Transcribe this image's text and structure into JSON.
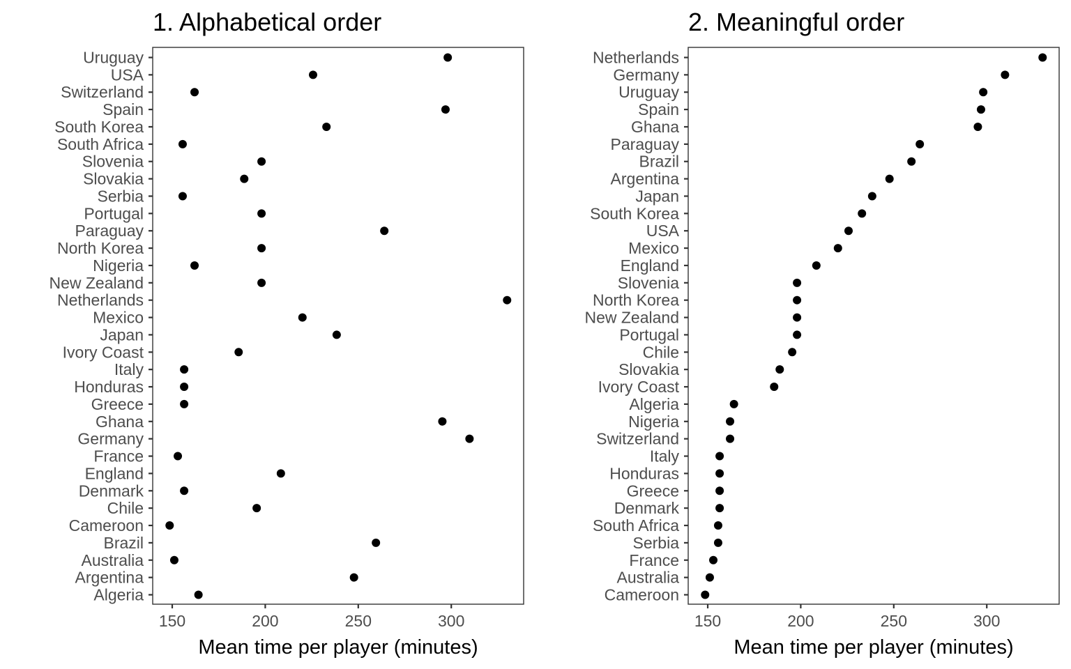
{
  "chart_data": [
    {
      "type": "scatter",
      "title": "1. Alphabetical order",
      "xlabel": "Mean time per player (minutes)",
      "ylabel": "",
      "xlim": [
        139.5,
        338.9
      ],
      "xticks": [
        150,
        200,
        250,
        300
      ],
      "grid": false,
      "legend": "none",
      "categories": [
        "Uruguay",
        "USA",
        "Switzerland",
        "Spain",
        "South Korea",
        "South Africa",
        "Slovenia",
        "Slovakia",
        "Serbia",
        "Portugal",
        "Paraguay",
        "North Korea",
        "Nigeria",
        "New Zealand",
        "Netherlands",
        "Mexico",
        "Japan",
        "Ivory Coast",
        "Italy",
        "Honduras",
        "Greece",
        "Ghana",
        "Germany",
        "France",
        "England",
        "Denmark",
        "Chile",
        "Cameroon",
        "Brazil",
        "Australia",
        "Argentina",
        "Algeria"
      ],
      "values": [
        298.1,
        225.7,
        162.0,
        296.9,
        232.9,
        155.6,
        198.0,
        188.7,
        155.6,
        198.0,
        264.0,
        198.0,
        162.0,
        198.0,
        330.0,
        220.0,
        238.4,
        185.7,
        156.4,
        156.4,
        156.4,
        295.2,
        309.8,
        153.0,
        208.4,
        156.4,
        195.4,
        148.6,
        259.5,
        151.1,
        247.7,
        164.1
      ]
    },
    {
      "type": "scatter",
      "title": "2. Meaningful order",
      "xlabel": "Mean time per player (minutes)",
      "ylabel": "",
      "xlim": [
        139.5,
        338.9
      ],
      "xticks": [
        150,
        200,
        250,
        300
      ],
      "grid": false,
      "legend": "none",
      "categories": [
        "Netherlands",
        "Germany",
        "Uruguay",
        "Spain",
        "Ghana",
        "Paraguay",
        "Brazil",
        "Argentina",
        "Japan",
        "South Korea",
        "USA",
        "Mexico",
        "England",
        "Slovenia",
        "North Korea",
        "New Zealand",
        "Portugal",
        "Chile",
        "Slovakia",
        "Ivory Coast",
        "Algeria",
        "Nigeria",
        "Switzerland",
        "Italy",
        "Honduras",
        "Greece",
        "Denmark",
        "South Africa",
        "Serbia",
        "France",
        "Australia",
        "Cameroon"
      ],
      "values": [
        330.0,
        309.8,
        298.1,
        296.9,
        295.2,
        264.0,
        259.5,
        247.7,
        238.4,
        232.9,
        225.7,
        220.0,
        208.4,
        198.0,
        198.0,
        198.0,
        198.0,
        195.4,
        188.7,
        185.7,
        164.1,
        162.0,
        162.0,
        156.4,
        156.4,
        156.4,
        156.4,
        155.6,
        155.6,
        153.0,
        151.1,
        148.6
      ]
    }
  ]
}
